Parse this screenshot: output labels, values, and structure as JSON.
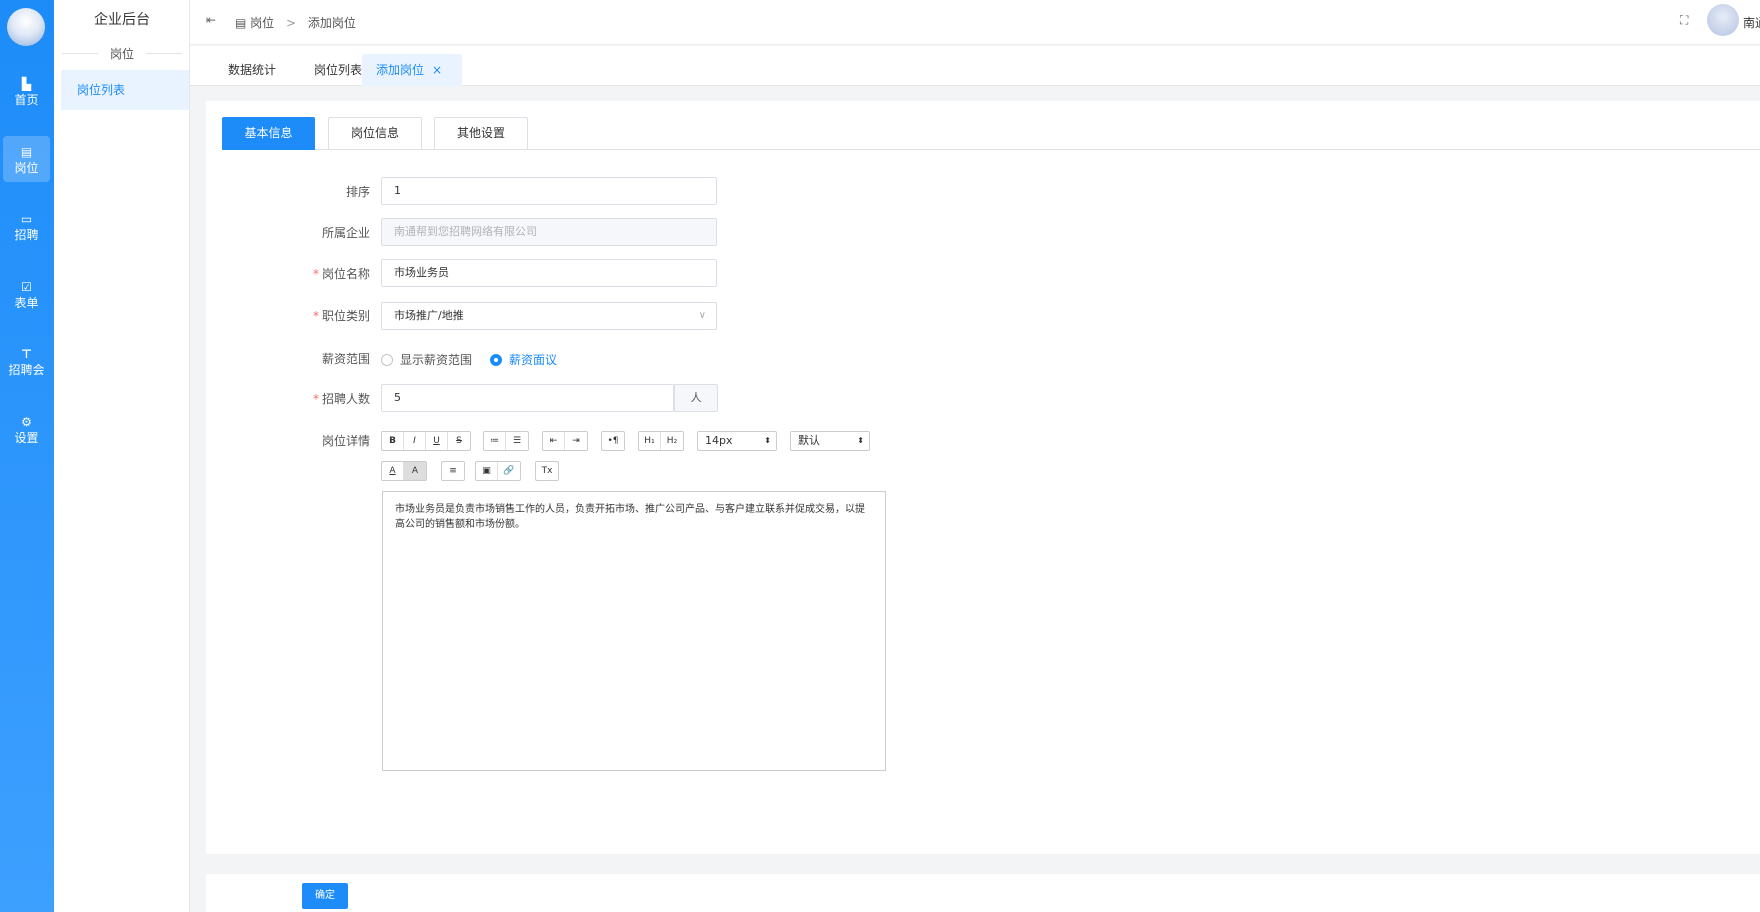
{
  "rail": {
    "items": [
      {
        "label": "首页",
        "icon": "bar-chart-icon"
      },
      {
        "label": "岗位",
        "icon": "document-icon"
      },
      {
        "label": "招聘",
        "icon": "calendar-icon"
      },
      {
        "label": "表单",
        "icon": "form-edit-icon"
      },
      {
        "label": "招聘会",
        "icon": "booth-icon"
      },
      {
        "label": "设置",
        "icon": "gear-icon"
      }
    ]
  },
  "sidebar": {
    "title": "企业后台",
    "group": "岗位",
    "menu_item": "岗位列表"
  },
  "header": {
    "crumb_root": "岗位",
    "crumb_sep": ">",
    "crumb_current": "添加岗位",
    "user_name": "南通"
  },
  "tabs": {
    "items": [
      "数据统计",
      "岗位列表",
      "添加岗位"
    ],
    "close": "×"
  },
  "subtabs": [
    "基本信息",
    "岗位信息",
    "其他设置"
  ],
  "form": {
    "sort": {
      "label": "排序",
      "value": "1"
    },
    "company": {
      "label": "所属企业",
      "placeholder": "南通帮到您招聘网络有限公司"
    },
    "name": {
      "label": "岗位名称",
      "value": "市场业务员"
    },
    "category": {
      "label": "职位类别",
      "value": "市场推广/地推"
    },
    "salary": {
      "label": "薪资范围",
      "option_show": "显示薪资范围",
      "option_negotiable": "薪资面议"
    },
    "headcount": {
      "label": "招聘人数",
      "value": "5",
      "unit": "人"
    },
    "detail": {
      "label": "岗位详情",
      "content": "市场业务员是负责市场销售工作的人员，负责开拓市场、推广公司产品、与客户建立联系并促成交易，以提高公司的销售额和市场份额。"
    }
  },
  "toolbar": {
    "fmt": [
      "B",
      "I",
      "U",
      "S"
    ],
    "lists": [
      "≔",
      "☰"
    ],
    "indent": [
      "⇤",
      "⇥"
    ],
    "para": [
      "•¶"
    ],
    "heading": [
      "H₁",
      "H₂"
    ],
    "font_size": "14px",
    "font_family": "默认",
    "color": [
      "A",
      "A"
    ],
    "align": [
      "≡"
    ],
    "media": [
      "▣",
      "🔗"
    ],
    "clear": [
      "Tx"
    ]
  },
  "submit_label": "确定",
  "colors": {
    "primary": "#1d8cf8",
    "rail": "#1d8cf8",
    "required": "#f56c6c"
  }
}
